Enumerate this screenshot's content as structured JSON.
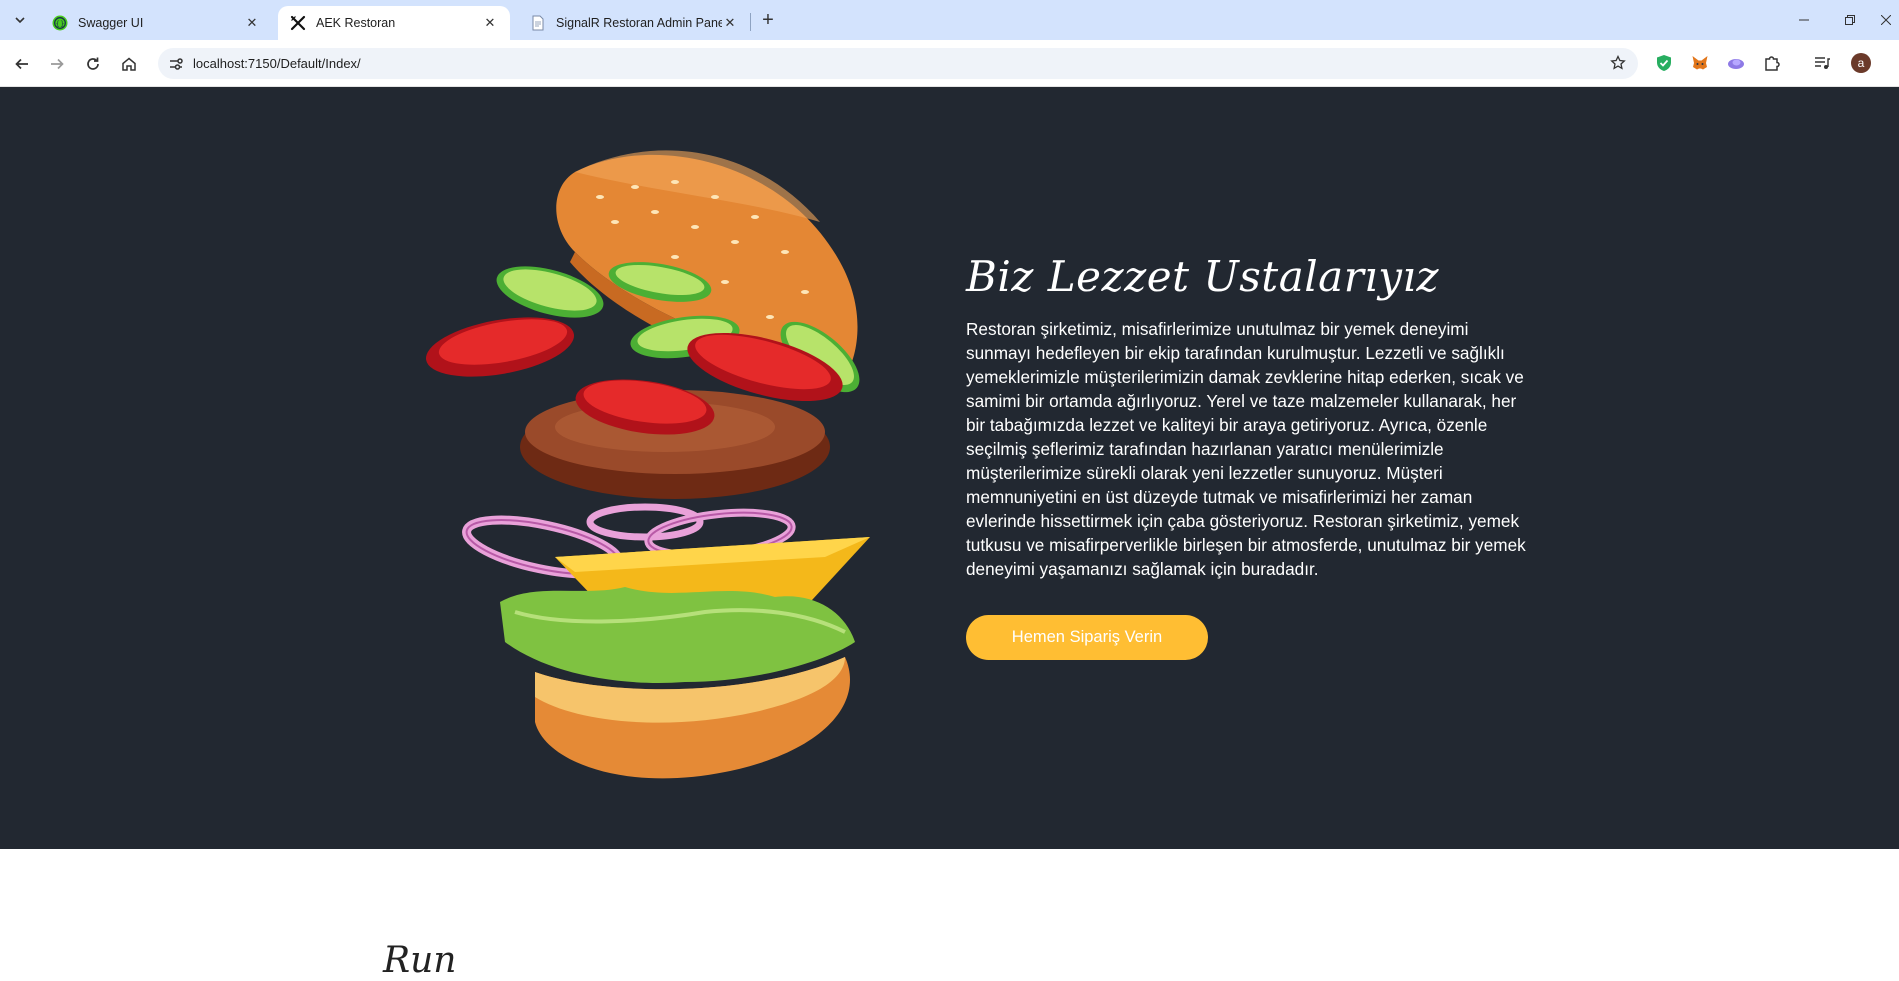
{
  "browser": {
    "tabs": [
      {
        "title": "Swagger UI",
        "favicon": "swagger-icon"
      },
      {
        "title": "AEK Restoran",
        "favicon": "restaurant-icon"
      },
      {
        "title": "SignalR Restoran Admin Paneli",
        "favicon": "document-icon"
      }
    ],
    "address_bar": {
      "url": "localhost:7150/Default/Index/"
    },
    "profile_initial": "a",
    "colors": {
      "tabstrip": "#d3e3fd",
      "omnibox": "#eff3f9"
    }
  },
  "hero": {
    "title": "Biz Lezzet Ustalarıyız",
    "description": "Restoran şirketimiz, misafirlerimize unutulmaz bir yemek deneyimi sunmayı hedefleyen bir ekip tarafından kurulmuştur. Lezzetli ve sağlıklı yemeklerimizle müşterilerimizin damak zevklerine hitap ederken, sıcak ve samimi bir ortamda ağırlıyoruz. Yerel ve taze malzemeler kullanarak, her bir tabağımızda lezzet ve kaliteyi bir araya getiriyoruz. Ayrıca, özenle seçilmiş şeflerimiz tarafından hazırlanan yaratıcı menülerimizle müşterilerimize sürekli olarak yeni lezzetler sunuyoruz. Müşteri memnuniyetini en üst düzeyde tutmak ve misafirlerimizi her zaman evlerinde hissettirmek için çaba gösteriyoruz. Restoran şirketimiz, yemek tutkusu ve misafirperverlikle birleşen bir atmosferde, unutulmaz bir yemek deneyimi yaşamanızı sağlamak için buradadır.",
    "button_label": "Hemen Sipariş Verin",
    "image": "burger-illustration",
    "colors": {
      "background": "#222831",
      "button": "#ffbe33"
    }
  },
  "next_section": {
    "heading_partial": "Run"
  }
}
